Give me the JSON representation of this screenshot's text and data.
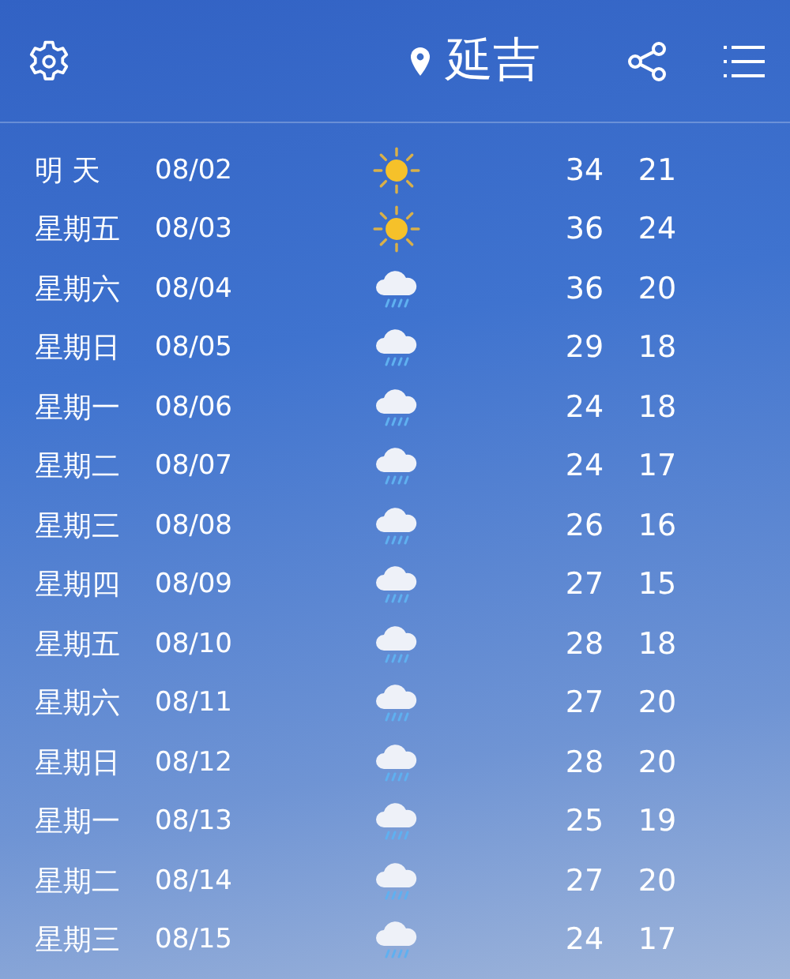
{
  "header": {
    "city": "延吉"
  },
  "forecast": [
    {
      "day": "明 天",
      "date": "08/02",
      "kind": "sunny",
      "high": "34",
      "low": "21"
    },
    {
      "day": "星期五",
      "date": "08/03",
      "kind": "sunny",
      "high": "36",
      "low": "24"
    },
    {
      "day": "星期六",
      "date": "08/04",
      "kind": "rain",
      "high": "36",
      "low": "20"
    },
    {
      "day": "星期日",
      "date": "08/05",
      "kind": "rain",
      "high": "29",
      "low": "18"
    },
    {
      "day": "星期一",
      "date": "08/06",
      "kind": "rain",
      "high": "24",
      "low": "18"
    },
    {
      "day": "星期二",
      "date": "08/07",
      "kind": "rain",
      "high": "24",
      "low": "17"
    },
    {
      "day": "星期三",
      "date": "08/08",
      "kind": "rain",
      "high": "26",
      "low": "16"
    },
    {
      "day": "星期四",
      "date": "08/09",
      "kind": "rain",
      "high": "27",
      "low": "15"
    },
    {
      "day": "星期五",
      "date": "08/10",
      "kind": "rain",
      "high": "28",
      "low": "18"
    },
    {
      "day": "星期六",
      "date": "08/11",
      "kind": "rain",
      "high": "27",
      "low": "20"
    },
    {
      "day": "星期日",
      "date": "08/12",
      "kind": "rain",
      "high": "28",
      "low": "20"
    },
    {
      "day": "星期一",
      "date": "08/13",
      "kind": "rain",
      "high": "25",
      "low": "19"
    },
    {
      "day": "星期二",
      "date": "08/14",
      "kind": "rain",
      "high": "27",
      "low": "20"
    },
    {
      "day": "星期三",
      "date": "08/15",
      "kind": "rain",
      "high": "24",
      "low": "17"
    }
  ]
}
